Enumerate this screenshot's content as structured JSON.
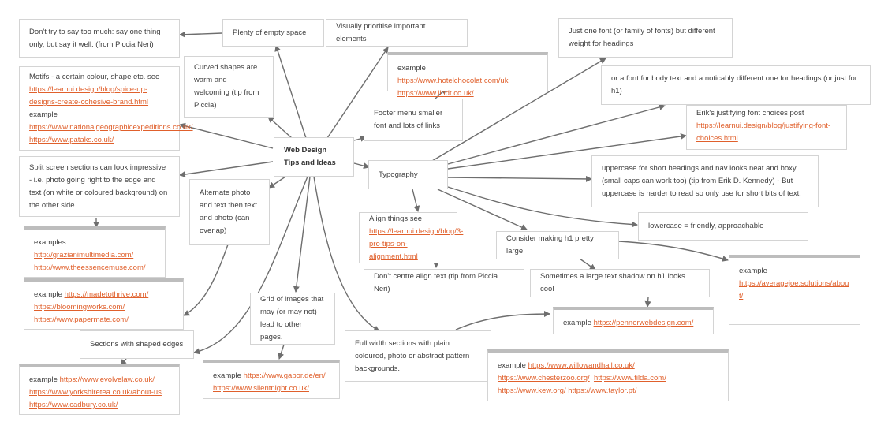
{
  "diagram": {
    "title": "Web Design Tips and Ideas",
    "link_color": "#e0602c",
    "line_color": "#6e6e6e",
    "nodes": {
      "center": {
        "text": "Web Design Tips and Ideas"
      },
      "dont_say_too_much": {
        "text": "Don't try to say too much: say one thing only, but say it well. (from Piccia Neri)"
      },
      "empty_space": {
        "text": "Plenty of empty space"
      },
      "visually_prioritise": {
        "text": "Visually prioritise important elements"
      },
      "curved_shapes": {
        "text": "Curved shapes are warm and welcoming (tip from Piccia)"
      },
      "motifs": {
        "text": "Motifs - a certain colour, shape etc. see",
        "link1": "https://learnui.design/blog/spice-up-designs-create-cohesive-brand.html",
        "example_label": "example",
        "link2": "https://www.nationalgeographicexpeditions.co.uk/",
        "link3": "https://www.pataks.co.uk/"
      },
      "split_screen": {
        "text": "Split screen sections can look impressive - i.e. photo going right to the edge and text (on white or coloured background) on the other side."
      },
      "split_examples": {
        "label": "examples",
        "link1": "http://grazianimultimedia.com/",
        "link2": "http://www.theessencemuse.com/"
      },
      "alternate_photo": {
        "text": "Alternate photo and text then text and photo (can overlap)"
      },
      "alternate_examples": {
        "label": "example",
        "link1": "https://madetothrive.com/",
        "link2": "https://bloomingworks.com/",
        "link3": "https://www.papermate.com/"
      },
      "shaped_edges": {
        "text": "Sections with shaped edges"
      },
      "shaped_examples": {
        "label": "example",
        "link1": "https://www.evolvelaw.co.uk/",
        "link2": "https://www.yorkshiretea.co.uk/about-us",
        "link3": "https://www.cadbury.co.uk/"
      },
      "grid_images": {
        "text": "Grid of images that may (or may not) lead to other pages."
      },
      "grid_examples": {
        "label": "example",
        "link1": "https://www.gabor.de/en/",
        "link2": "https://www.silentnight.co.uk/"
      },
      "footer_menu": {
        "text": "Footer menu smaller font and lots of links"
      },
      "footer_examples": {
        "label": "example",
        "link1": "https://www.hotelchocolat.com/uk",
        "link2": "https://www.lindt.co.uk/"
      },
      "full_width": {
        "text": "Full width sections with plain coloured, photo or abstract pattern backgrounds."
      },
      "full_width_examples": {
        "label": "example",
        "link1": "https://www.willowandhall.co.uk/",
        "link2": "https://www.chesterzoo.org/",
        "link3": "https://www.tilda.com/",
        "link4": "https://www.kew.org/",
        "link5": "https://www.taylor.pt/"
      },
      "typography": {
        "text": "Typography"
      },
      "one_font": {
        "text": "Just one font (or family of fonts) but different weight for headings"
      },
      "body_heading_font": {
        "text": "or a font for body text and a noticably different one for headings (or just for h1)"
      },
      "erik_post": {
        "text": "Erik's justifying font choices post",
        "link1": "https://learnui.design/blog/justifying-font-choices.html"
      },
      "uppercase": {
        "text": "uppercase for short headings and nav looks neat and boxy (small caps can work too) (tip from Erik D. Kennedy)  - But uppercase is harder to read so only use for short bits of text."
      },
      "lowercase": {
        "text": "lowercase = friendly, approachable"
      },
      "align_things": {
        "text": "Align things see",
        "link1": "https://learnui.design/blog/3-pro-tips-on-alignment.html"
      },
      "dont_centre": {
        "text": "Don't centre align text (tip from Piccia Neri)"
      },
      "h1_large": {
        "text": "Consider making h1 pretty large"
      },
      "h1_example": {
        "label": "example",
        "link1": "https://averagejoe.solutions/about/"
      },
      "text_shadow": {
        "text": "Sometimes a large text shadow on h1 looks cool"
      },
      "shadow_example": {
        "label": "example",
        "link1": "https://pennerwebdesign.com/"
      }
    }
  }
}
